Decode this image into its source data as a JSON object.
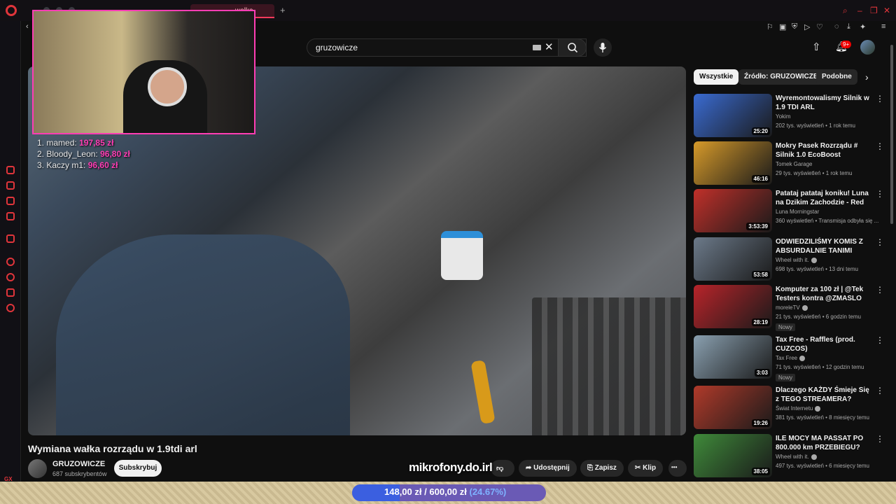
{
  "browser": {
    "active_tab_label": "wałka",
    "new_tab_symbol": "+"
  },
  "search": {
    "query": "gruzowicze"
  },
  "header": {
    "notification_count": "9+"
  },
  "stream_overlay": {
    "donors": [
      {
        "rank": "1.",
        "name": "mamed:",
        "amount": "197,85 zł"
      },
      {
        "rank": "2.",
        "name": "Bloody_Leon:",
        "amount": "96,80 zł"
      },
      {
        "rank": "3.",
        "name": "Kaczy m1:",
        "amount": "96,60 zł"
      }
    ],
    "sponsor_logo": "mikrofony.do.irl",
    "goal": {
      "current": "148,00 zł",
      "separator": "/",
      "target": "600,00 zł",
      "percent_label": "(24.67%)",
      "progress": 0.2467
    }
  },
  "video": {
    "title": "Wymiana wałka rozrządu w 1.9tdi arl",
    "channel_name": "GRUZOWICZE",
    "subscribers": "687 subskrybentów",
    "subscribe_label": "Subskrybuj",
    "share_label": "Udostępnij",
    "save_label": "Zapisz",
    "clip_label": "Klip",
    "more_label": "•••"
  },
  "filters": {
    "chips": [
      "Wszystkie",
      "Źródło: GRUZOWICZE",
      "Podobne"
    ]
  },
  "recommendations": [
    {
      "title": "Wyremontowalismy Silnik w 1.9 TDI ARL",
      "channel": "Yokim",
      "verified": false,
      "meta": "202 tys. wyświetleń • 1 rok temu",
      "duration": "25:20",
      "badge": "",
      "thumb_color": "#3a6bd1"
    },
    {
      "title": "Mokry Pasek Rozrządu # Silnik 1.0 EcoBoost",
      "channel": "Tomek Garage",
      "verified": false,
      "meta": "29 tys. wyświetleń • 1 rok temu",
      "duration": "46:16",
      "badge": "",
      "thumb_color": "#d69a2a"
    },
    {
      "title": "Patataj patataj koniku! Luna na Dzikim Zachodzie - Red Dead ...",
      "channel": "Luna Morningstar",
      "verified": false,
      "meta": "360 wyświetleń • Transmisja odbyła się ...",
      "duration": "3:53:39",
      "badge": "",
      "thumb_color": "#c0302a"
    },
    {
      "title": "ODWIEDZILIŚMY KOMIS Z ABSURDALNIE TANIMI AUTAMI",
      "channel": "Wheel with it.",
      "verified": true,
      "meta": "698 tys. wyświetleń • 13 dni temu",
      "duration": "53:58",
      "badge": "",
      "thumb_color": "#6c7a8a"
    },
    {
      "title": "Komputer za 100 zł | @Tek Testers kontra @ZMASLO",
      "channel": "moreleTV",
      "verified": true,
      "meta": "21 tys. wyświetleń • 6 godzin temu",
      "duration": "28:19",
      "badge": "Nowy",
      "thumb_color": "#b8242a"
    },
    {
      "title": "Tax Free - Raffles (prod. CUZCOS)",
      "channel": "Tax Free",
      "verified": true,
      "meta": "71 tys. wyświetleń • 12 godzin temu",
      "duration": "3:03",
      "badge": "Nowy",
      "thumb_color": "#8aa0b0"
    },
    {
      "title": "Dlaczego KAŻDY Śmieje Się z TEGO STREAMERA?",
      "channel": "Świat Internetu",
      "verified": true,
      "meta": "381 tys. wyświetleń • 8 miesięcy temu",
      "duration": "19:26",
      "badge": "",
      "thumb_color": "#b03a2a"
    },
    {
      "title": "ILE MOCY MA PASSAT PO 800.000 km PRZEBIEGU?",
      "channel": "Wheel with it.",
      "verified": true,
      "meta": "497 tys. wyświetleń • 6 miesięcy temu",
      "duration": "38:05",
      "badge": "",
      "thumb_color": "#3f8a3a"
    }
  ]
}
